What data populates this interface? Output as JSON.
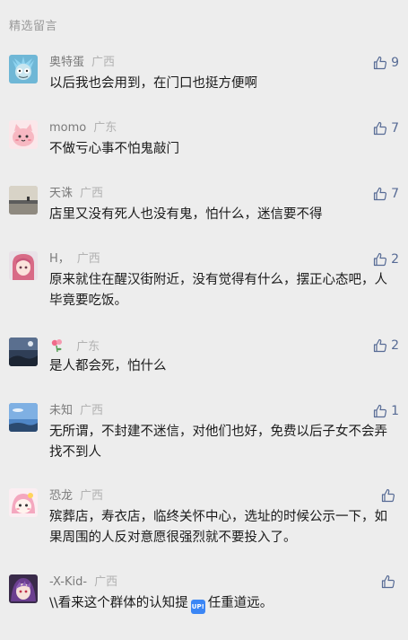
{
  "section_title": "精选留言",
  "comments": [
    {
      "nickname": "奥特蛋",
      "location": "广西",
      "likes": "9",
      "text": "以后我也会用到，在门口也挺方便啊",
      "avatar": "rick-avatar"
    },
    {
      "nickname": "momo",
      "location": "广东",
      "likes": "7",
      "text": "不做亏心事不怕鬼敲门",
      "avatar": "pink-cat-avatar"
    },
    {
      "nickname": "天诛",
      "location": "广西",
      "likes": "7",
      "text": "店里又没有死人也没有鬼，怕什么，迷信要不得",
      "avatar": "landscape-avatar"
    },
    {
      "nickname": "H，",
      "location": "广西",
      "likes": "2",
      "text": "原来就住在醒汉街附近，没有觉得有什么，摆正心态吧，人毕竟要吃饭。",
      "avatar": "anime-girl-avatar"
    },
    {
      "nickname": "",
      "location": "广东",
      "likes": "2",
      "text": "是人都会死，怕什么",
      "avatar": "night-avatar"
    },
    {
      "nickname": "未知",
      "location": "广西",
      "likes": "1",
      "text": "无所谓，不封建不迷信，对他们也好，免费以后子女不会弄找不到人",
      "avatar": "blue-sky-avatar"
    },
    {
      "nickname": "恐龙",
      "location": "广西",
      "likes": "",
      "text": "殡葬店，寿衣店，临终关怀中心，选址的时候公示一下，如果周围的人反对意愿很强烈就不要投入了。",
      "avatar": "pink-character-avatar"
    },
    {
      "nickname": "-X-Kid-",
      "location": "广西",
      "likes": "",
      "text_before": "\\\\看来这个群体的认知提",
      "badge": "UP!",
      "text_after": "任重道远。",
      "avatar": "anime-boy-avatar"
    }
  ]
}
